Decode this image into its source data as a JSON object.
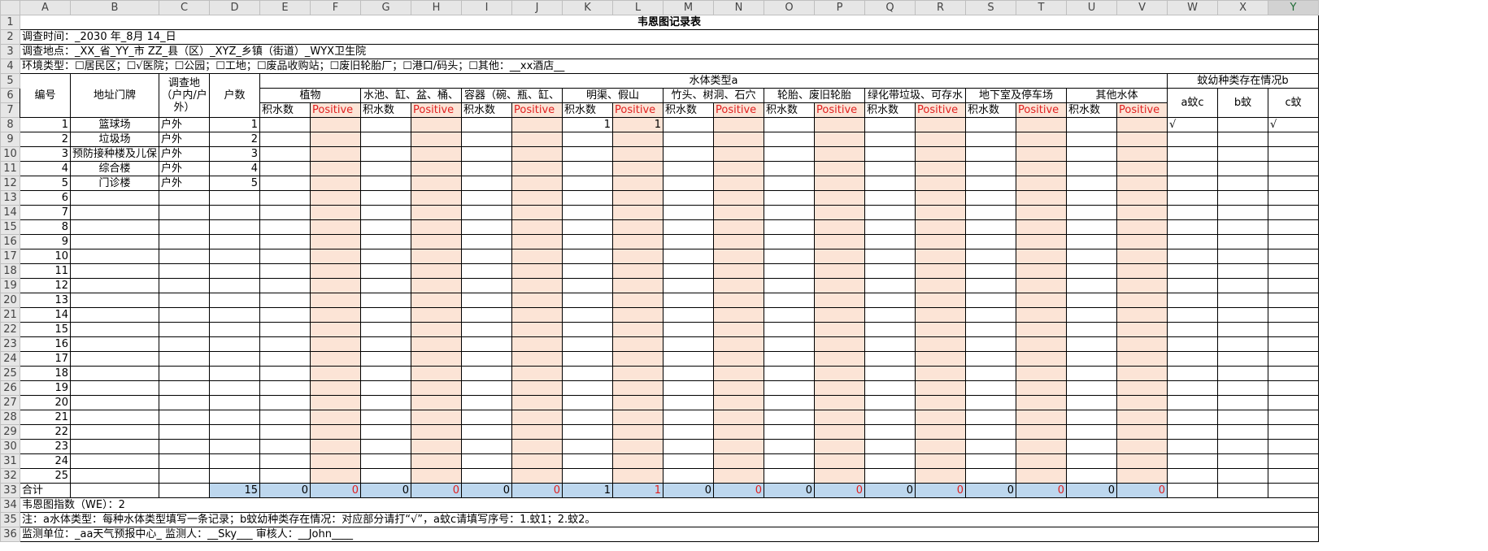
{
  "columns": [
    "A",
    "B",
    "C",
    "D",
    "E",
    "F",
    "G",
    "H",
    "I",
    "J",
    "K",
    "L",
    "M",
    "N",
    "O",
    "P",
    "Q",
    "R",
    "S",
    "T",
    "U",
    "V",
    "W",
    "X",
    "Y"
  ],
  "selected_column": "Y",
  "title": "韦恩图记录表",
  "survey_time": "调查时间：_2030 年_8月   14_日",
  "survey_place": "调查地点：_XX_省_YY_市 ZZ_县（区）_XYZ_乡镇（街道）_WYX卫生院",
  "env_type": "环境类型：☐居民区；☐√医院；☐公园；☐工地；☐废品收购站；☐废旧轮胎厂；☐港口/码头；☐其他：__xx酒店__",
  "headers": {
    "no": "编号",
    "address": "地址门牌",
    "place": "调查地（户内/户外）",
    "households": "户数",
    "water_type": "水体类型a",
    "mosquito": "蚊幼种类存在情况b",
    "categories": [
      "植物",
      "水池、缸、盆、桶、",
      "容器（碗、瓶、缸、",
      "明渠、假山",
      "竹头、树洞、石穴",
      "轮胎、废旧轮胎",
      "绿化带垃圾、可存水",
      "地下室及停车场",
      "其他水体"
    ],
    "sub_a": "积水数",
    "sub_b": "Positive",
    "mosq_types": [
      "a蚊c",
      "b蚊",
      "c蚊"
    ]
  },
  "rows": [
    {
      "no": "1",
      "addr": "篮球场",
      "place": "户外",
      "hh": "1",
      "k": "1",
      "l": "1",
      "w": "√",
      "y": "√"
    },
    {
      "no": "2",
      "addr": "垃圾场",
      "place": "户外",
      "hh": "2",
      "k": "",
      "l": "",
      "w": "",
      "y": ""
    },
    {
      "no": "3",
      "addr": "预防接种楼及儿保",
      "place": "户外",
      "hh": "3",
      "k": "",
      "l": "",
      "w": "",
      "y": ""
    },
    {
      "no": "4",
      "addr": "综合楼",
      "place": "户外",
      "hh": "4",
      "k": "",
      "l": "",
      "w": "",
      "y": ""
    },
    {
      "no": "5",
      "addr": "门诊楼",
      "place": "户外",
      "hh": "5",
      "k": "",
      "l": "",
      "w": "",
      "y": ""
    },
    {
      "no": "6"
    },
    {
      "no": "7"
    },
    {
      "no": "8"
    },
    {
      "no": "9"
    },
    {
      "no": "10"
    },
    {
      "no": "11"
    },
    {
      "no": "12"
    },
    {
      "no": "13"
    },
    {
      "no": "14"
    },
    {
      "no": "15"
    },
    {
      "no": "16"
    },
    {
      "no": "17"
    },
    {
      "no": "18"
    },
    {
      "no": "19"
    },
    {
      "no": "20"
    },
    {
      "no": "21"
    },
    {
      "no": "22"
    },
    {
      "no": "23"
    },
    {
      "no": "24"
    },
    {
      "no": "25"
    }
  ],
  "total_label": "合计",
  "totals": {
    "hh": "15",
    "pairs": [
      [
        "0",
        "0"
      ],
      [
        "0",
        "0"
      ],
      [
        "0",
        "0"
      ],
      [
        "1",
        "1"
      ],
      [
        "0",
        "0"
      ],
      [
        "0",
        "0"
      ],
      [
        "0",
        "0"
      ],
      [
        "0",
        "0"
      ],
      [
        "0",
        "0"
      ]
    ]
  },
  "bi_index": "韦恩图指数（WE）：2",
  "note": "注：a水体类型：每种水体类型填写一条记录；b蚊幼种类存在情况：对应部分请打“√”，a蚊c请填写序号：1.蚊1；2.蚊2。",
  "monitor": "监测单位：_aa天气预报中心_  监测人：__Sky___  审核人：__John____"
}
